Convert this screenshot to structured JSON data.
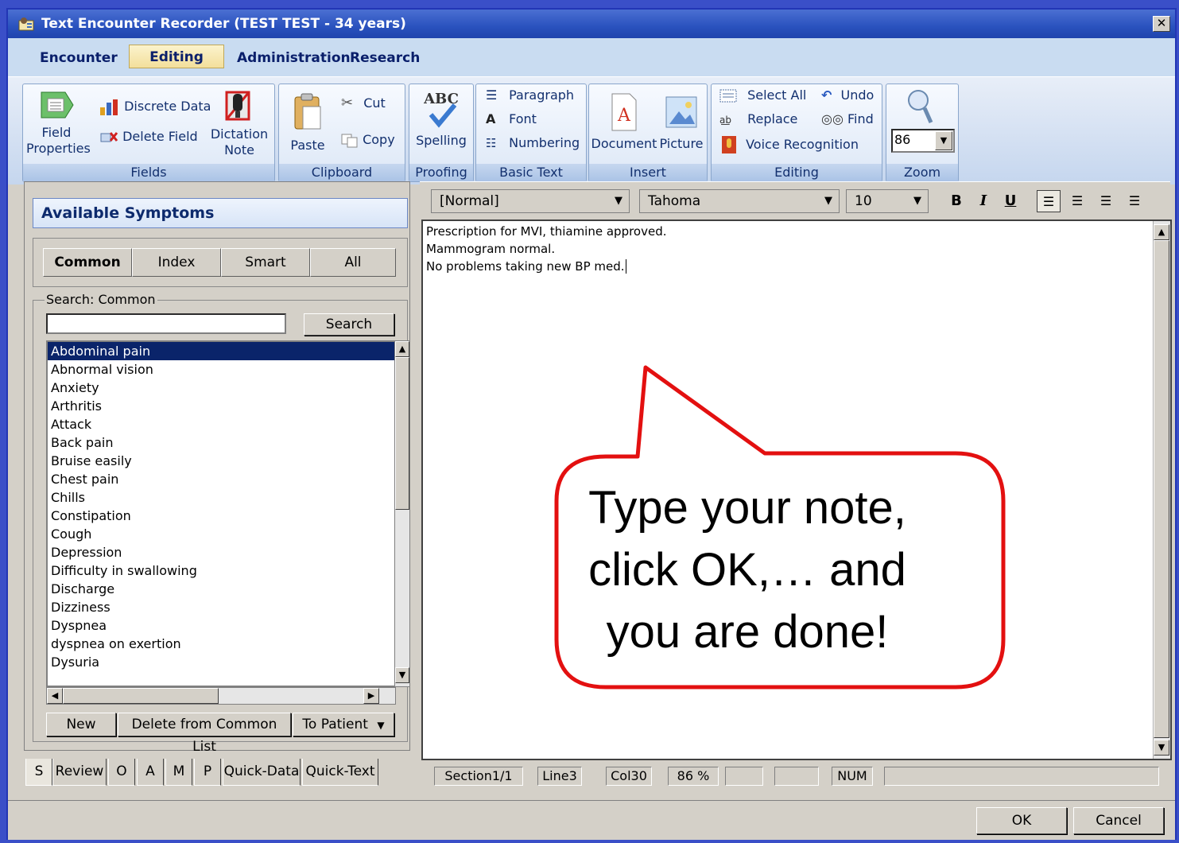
{
  "window": {
    "title": "Text Encounter Recorder (TEST TEST - 34 years)"
  },
  "menu": [
    "Encounter",
    "Editing",
    "Administration",
    "Research"
  ],
  "ribbon": {
    "fields": {
      "label": "Fields",
      "field_properties_1": "Field",
      "field_properties_2": "Properties",
      "discrete_data": "Discrete Data",
      "delete_field": "Delete Field",
      "dictation_1": "Dictation",
      "dictation_2": "Note"
    },
    "clipboard": {
      "label": "Clipboard",
      "paste": "Paste",
      "cut": "Cut",
      "copy": "Copy"
    },
    "proofing": {
      "label": "Proofing",
      "spelling": "Spelling"
    },
    "basic_text": {
      "label": "Basic Text",
      "paragraph": "Paragraph",
      "font": "Font",
      "numbering": "Numbering"
    },
    "insert": {
      "label": "Insert",
      "document": "Document",
      "picture": "Picture"
    },
    "editing": {
      "label": "Editing",
      "select_all": "Select All",
      "undo": "Undo",
      "replace": "Replace",
      "find": "Find",
      "voice": "Voice Recognition"
    },
    "zoom": {
      "label": "Zoom",
      "value": "86"
    }
  },
  "symptoms": {
    "title": "Available Symptoms",
    "tabs": [
      "Common",
      "Index",
      "Smart",
      "All"
    ],
    "search_legend": "Search: Common",
    "search_value": "",
    "search_button": "Search",
    "items": [
      "Abdominal pain",
      "Abnormal vision",
      "Anxiety",
      "Arthritis",
      "Attack",
      "Back pain",
      "Bruise easily",
      "Chest pain",
      "Chills",
      "Constipation",
      "Cough",
      "Depression",
      "Difficulty in swallowing",
      "Discharge",
      "Dizziness",
      "Dyspnea",
      "dyspnea on exertion",
      "Dysuria"
    ],
    "new_button": "New",
    "delete_button": "Delete from Common List",
    "to_patient_button": "To Patient"
  },
  "bottom_tabs": [
    "S",
    "Review",
    "O",
    "A",
    "M",
    "P",
    "Quick-Data",
    "Quick-Text"
  ],
  "editor_toolbar": {
    "style": "[Normal]",
    "font": "Tahoma",
    "size": "10",
    "bold": "B",
    "italic": "I",
    "underline": "U"
  },
  "editor_lines": [
    "Prescription for MVI, thiamine approved.",
    "Mammogram normal.",
    "No problems taking new BP med."
  ],
  "status": {
    "section": "Section1/1",
    "line": "Line3",
    "col": "Col30",
    "zoom": "86 %",
    "num": "NUM"
  },
  "callout": {
    "line1": "Type your note,",
    "line2": "click OK,… and",
    "line3": "you are done!"
  },
  "buttons": {
    "ok": "OK",
    "cancel": "Cancel"
  }
}
